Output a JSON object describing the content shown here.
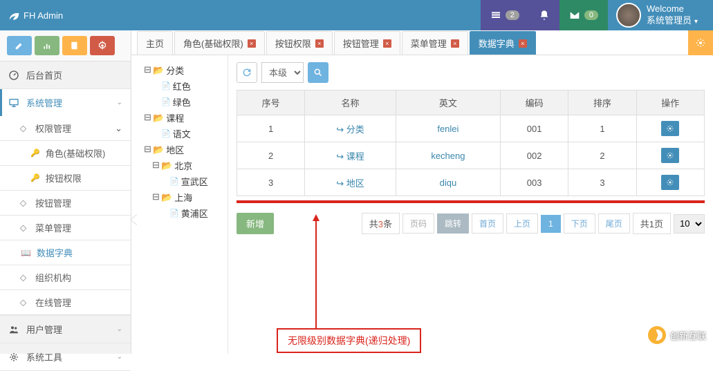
{
  "brand": "FH Admin",
  "nav": {
    "msg_count": "2",
    "mail_count": "0",
    "welcome": "Welcome",
    "user": "系统管理员"
  },
  "shortcuts": [
    "pencil",
    "bars",
    "book",
    "gear"
  ],
  "sidebar": {
    "home": "后台首页",
    "sys": "系统管理",
    "sys_sub": {
      "perm": "权限管理",
      "role": "角色(基础权限)",
      "btnperm": "按钮权限",
      "btnmgmt": "按钮管理",
      "menumgmt": "菜单管理",
      "dict": "数据字典",
      "org": "组织机构",
      "online": "在线管理"
    },
    "usermgmt": "用户管理",
    "tools": "系统工具"
  },
  "tabs": [
    "主页",
    "角色(基础权限)",
    "按钮权限",
    "按钮管理",
    "菜单管理",
    "数据字典"
  ],
  "tree": {
    "cat": "分类",
    "red": "红色",
    "green": "绿色",
    "course": "课程",
    "chinese": "语文",
    "region": "地区",
    "bj": "北京",
    "xw": "宣武区",
    "sh": "上海",
    "hp": "黄浦区"
  },
  "toolbar": {
    "level": "本级"
  },
  "table": {
    "headers": [
      "序号",
      "名称",
      "英文",
      "编码",
      "排序",
      "操作"
    ],
    "rows": [
      {
        "no": "1",
        "name": "分类",
        "en": "fenlei",
        "code": "001",
        "sort": "1"
      },
      {
        "no": "2",
        "name": "课程",
        "en": "kecheng",
        "code": "002",
        "sort": "2"
      },
      {
        "no": "3",
        "name": "地区",
        "en": "diqu",
        "code": "003",
        "sort": "3"
      }
    ]
  },
  "buttons": {
    "add": "新增"
  },
  "pager": {
    "total_pre": "共",
    "total_num": "3",
    "total_suf": "条",
    "page_ph": "页码",
    "jump": "跳转",
    "first": "首页",
    "prev": "上页",
    "cur": "1",
    "next": "下页",
    "last": "尾页",
    "pages_pre": "共",
    "pages_num": "1",
    "pages_suf": "页",
    "size": "10"
  },
  "annot": "无限级别数据字典(递归处理)",
  "watermark": "创新互联"
}
